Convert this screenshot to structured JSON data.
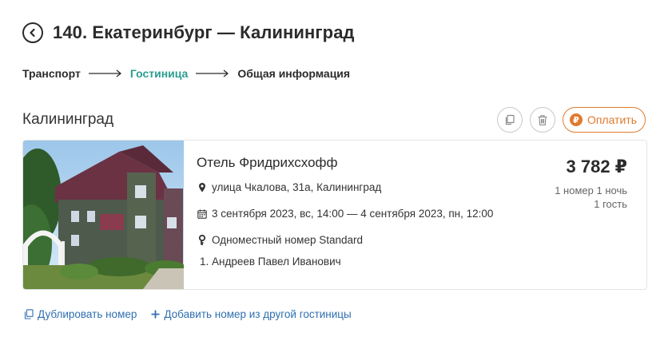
{
  "header": {
    "title": "140. Екатеринбург — Калининград"
  },
  "steps": [
    {
      "label": "Транспорт"
    },
    {
      "label": "Гостиница"
    },
    {
      "label": "Общая информация"
    }
  ],
  "colors": {
    "active_step": "#2a9d8f",
    "pay_accent": "#e07a2e",
    "link": "#2f6fb0"
  },
  "section": {
    "city": "Калининград",
    "pay_label": "Оплатить"
  },
  "hotel": {
    "name": "Отель Фридрихсхофф",
    "address": "улица Чкалова, 31а, Калининград",
    "dates": "3 сентября 2023, вс, 14:00 — 4 сентября 2023, пн, 12:00",
    "room_type": "Одноместный номер Standard",
    "guest": "1. Андреев Павел Иванович",
    "price": "3 782 ₽",
    "rooms_nights": "1 номер 1 ночь",
    "guests_count": "1 гость"
  },
  "links": {
    "duplicate": "Дублировать номер",
    "add_other": "Добавить номер из другой гостиницы"
  }
}
